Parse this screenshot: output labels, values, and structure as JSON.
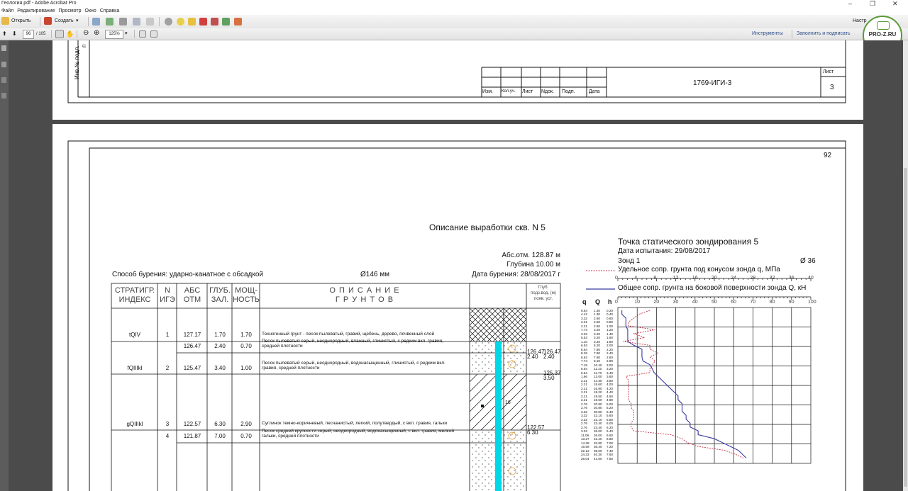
{
  "window": {
    "title": "Геология.pdf - Adobe Acrobat Pro",
    "controls": [
      "–",
      "❐",
      "✕"
    ]
  },
  "menu": [
    "Файл",
    "Редактирование",
    "Просмотр",
    "Окно",
    "Справка"
  ],
  "toolbar": {
    "open_label": "Открыть",
    "create_label": "Создать",
    "right_label": "Настр",
    "page_current": "96",
    "page_total": "/ 105",
    "zoom": "125%",
    "tools_label": "Инструменты",
    "fill_sign_label": "Заполнить и подписать"
  },
  "watermark": {
    "text": "PRO-Z.RU"
  },
  "prev_page": {
    "side_label": "Инв.№ подл.",
    "side_label2": "п",
    "stamp_headers": [
      "Изм.",
      "Кол.уч.",
      "Лист",
      "Nдок.",
      "Подп.",
      "Дата"
    ],
    "doc_code": "1769-ИГИ-3",
    "sheet_label": "Лист",
    "sheet_number": "3"
  },
  "page": {
    "number": "92",
    "title": "Описание выработки скв. N  5",
    "abs_otm": "Абс.отм.  128.87 м",
    "depth": "Глубина  10.00 м",
    "drill_date": "Дата бурения:  28/08/2017 г",
    "drill_method": "Способ бурения:  ударно-канатное с обсадкой",
    "diameter": "Ø146 мм",
    "headers": {
      "strat": [
        "СТРАТИГР.",
        "ИНДЕКС"
      ],
      "n": [
        "N",
        "ИГЭ"
      ],
      "abs": [
        "АБС",
        "ОТМ"
      ],
      "glub": [
        "ГЛУБ.",
        "ЗАЛ."
      ],
      "mosh": [
        "МОЩ-",
        "НОСТЬ"
      ],
      "desc": [
        "О П И С А Н И Е",
        "Г Р У Н Т О В"
      ],
      "water": [
        "Глуб.",
        "подз.вод. (м)",
        "появ.  уст."
      ]
    },
    "rows": [
      {
        "index": "tQIV",
        "n": "1",
        "abs": "127.17",
        "glub": "1.70",
        "mosh": "1.70",
        "desc": [
          "Техногенный грунт - песок пылеватый, гравий, щебень, дерево, почвенный слой"
        ]
      },
      {
        "index": "",
        "n": "",
        "abs": "126.47",
        "glub": "2.40",
        "mosh": "0.70",
        "desc": [
          "Песок пылеватый серый, неоднородный, влажный, глинистый, с редким вкл. гравия,",
          "средней плотности"
        ]
      },
      {
        "index": "fQIIIkl",
        "n": "2",
        "abs": "125.47",
        "glub": "3.40",
        "mosh": "1.00",
        "desc": [
          "Песок пылеватый серый, неоднородный, водонасыщенный, глинистый, с редким вкл.",
          "гравия, средней плотности"
        ]
      },
      {
        "index": "gQIIIkl",
        "n": "3",
        "abs": "122.57",
        "glub": "6.30",
        "mosh": "2.90",
        "desc": [
          "Суглинок темно-коричневый, песчанистый, легкий, полутвердый, с вкл. гравия, гальки"
        ]
      },
      {
        "index": "",
        "n": "4",
        "abs": "121.87",
        "glub": "7.00",
        "mosh": "0.70",
        "desc": [
          "Песок средней крупности серый, неоднородный, водонасыщенный, с вкл. гравия,  мелкой",
          "гальки, средней плотности"
        ]
      }
    ],
    "water_levels": [
      "126.47",
      "2.40",
      "126.47",
      "2.40",
      "125.37",
      "3.50",
      "122.57",
      "6.30"
    ],
    "column_labels": [
      "1",
      "2",
      "16",
      "3"
    ]
  },
  "cpt": {
    "title": "Точка статического зондирования 5",
    "date": "Дата испытания:  29/08/2017",
    "probe": "Зонд  1",
    "diameter": "Ø  36",
    "legend_q": "Удельное сопр. грунта под конусом зонда q, МПа",
    "legend_Q": "Общее сопр. грунта на боковой поверхности зонда Q, кН",
    "axis_q": [
      "0",
      "4",
      "8",
      "12",
      "16",
      "20",
      "24",
      "28",
      "32",
      "36",
      "40"
    ],
    "axis_Q": [
      "0",
      "10",
      "20",
      "30",
      "40",
      "50",
      "60",
      "70",
      "80",
      "90",
      "100"
    ],
    "col_q": "q",
    "col_Q": "Q",
    "col_h": "h",
    "q_values": [
      "6.64",
      "4.42",
      "3.32",
      "2.21",
      "2.21",
      "7.74",
      "3.32",
      "5.53",
      "1.10",
      "6.63",
      "6.64",
      "8.29",
      "6.63",
      "7.74",
      "7.18",
      "6.64",
      "6.64",
      "1.66",
      "2.21",
      "2.21",
      "2.21",
      "2.21",
      "2.21",
      "2.21",
      "2.76",
      "2.76",
      "3.32",
      "3.32",
      "3.32",
      "2.76",
      "2.76",
      "3.32",
      "11.06",
      "13.27",
      "14.38",
      "16.59",
      "22.12",
      "24.33",
      "26.04"
    ],
    "Q_values": [
      "1.30",
      "1.30",
      "2.60",
      "2.60",
      "2.60",
      "3.20",
      "3.20",
      "3.20",
      "3.20",
      "5.20",
      "7.80",
      "7.80",
      "7.80",
      "8.10",
      "10.40",
      "11.10",
      "11.70",
      "13.00",
      "14.30",
      "15.60",
      "16.90",
      "18.20",
      "19.50",
      "19.50",
      "20.80",
      "20.80",
      "20.80",
      "22.10",
      "22.10",
      "23.40",
      "23.40",
      "26.00",
      "26.00",
      "31.20",
      "33.80",
      "36.40",
      "39.00",
      "40.30",
      "41.60"
    ],
    "h_values": [
      "0.20",
      "0.40",
      "0.60",
      "0.80",
      "1.00",
      "1.20",
      "1.40",
      "1.60",
      "1.80",
      "2.00",
      "2.20",
      "2.40",
      "2.60",
      "2.80",
      "3.00",
      "3.20",
      "3.40",
      "3.60",
      "3.80",
      "4.00",
      "4.20",
      "4.40",
      "4.60",
      "4.80",
      "5.00",
      "5.20",
      "5.40",
      "5.60",
      "5.80",
      "6.00",
      "6.20",
      "6.40",
      "6.60",
      "6.80",
      "7.00",
      "7.20",
      "7.40",
      "7.60",
      "7.80"
    ]
  },
  "colors": {
    "accent": "#2a4a86",
    "water": "#00d8e8",
    "q_line": "#c0304a",
    "Q_line": "#3a3aa0"
  }
}
